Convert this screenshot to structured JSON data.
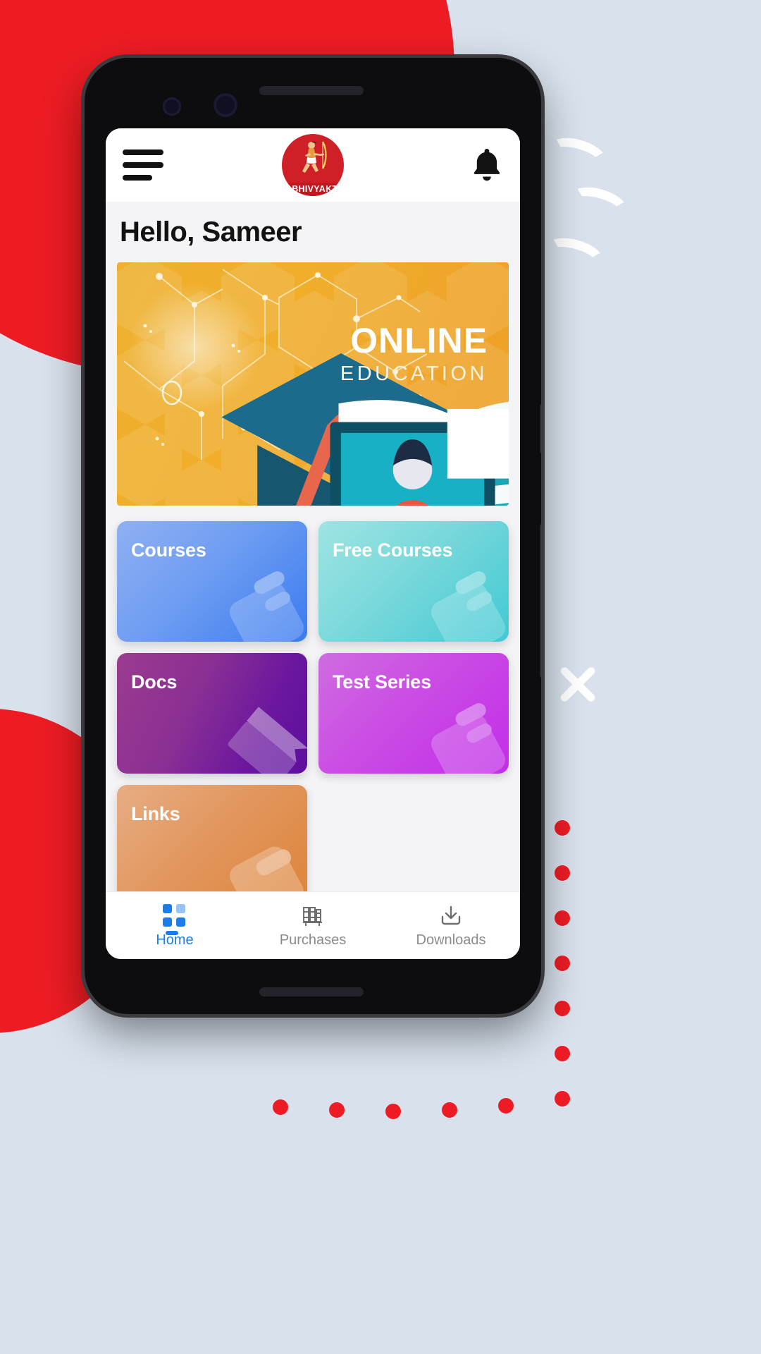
{
  "app": {
    "brand_name": "ABHIVYAKTI",
    "brand_color": "#cf2027",
    "accent_color": "#1a7de8",
    "background_color": "#f4f4f6"
  },
  "appbar": {
    "menu_icon": "hamburger-menu-icon",
    "logo_icon": "abhivyakti-logo-icon",
    "notification_icon": "bell-icon"
  },
  "greeting": {
    "text": "Hello, Sameer"
  },
  "banner": {
    "title": "ONLINE",
    "subtitle": "EDUCATION",
    "icons": [
      "graduation-cap-icon",
      "open-book-icon",
      "desktop-student-icon"
    ],
    "background_start": "#eeb02e",
    "background_end": "#eda026"
  },
  "tiles": [
    {
      "label": "Courses",
      "from": "#8fb0f2",
      "to": "#3a7bef",
      "deco": "book-card-icon"
    },
    {
      "label": "Free Courses",
      "from": "#8fdfe0",
      "to": "#42c9d4",
      "deco": "book-card-icon"
    },
    {
      "label": "Docs",
      "from": "#9b3c8f",
      "to": "#5d0f9e",
      "deco": "bookmark-icon"
    },
    {
      "label": "Test Series",
      "from": "#cf6ce0",
      "to": "#c22ee8",
      "deco": "book-card-icon"
    },
    {
      "label": "Links",
      "from": "#e3a478",
      "to": "#dd8439",
      "deco": "link-card-icon"
    }
  ],
  "bottom_nav": [
    {
      "label": "Home",
      "icon": "grid-icon",
      "active": true
    },
    {
      "label": "Purchases",
      "icon": "books-icon",
      "active": false
    },
    {
      "label": "Downloads",
      "icon": "download-icon",
      "active": false
    }
  ],
  "decoration": {
    "circle_color": "#ed1c24",
    "wave_color": "#ffffff",
    "x_icon": "close-x-icon",
    "page_background": "#d8e1ec"
  }
}
